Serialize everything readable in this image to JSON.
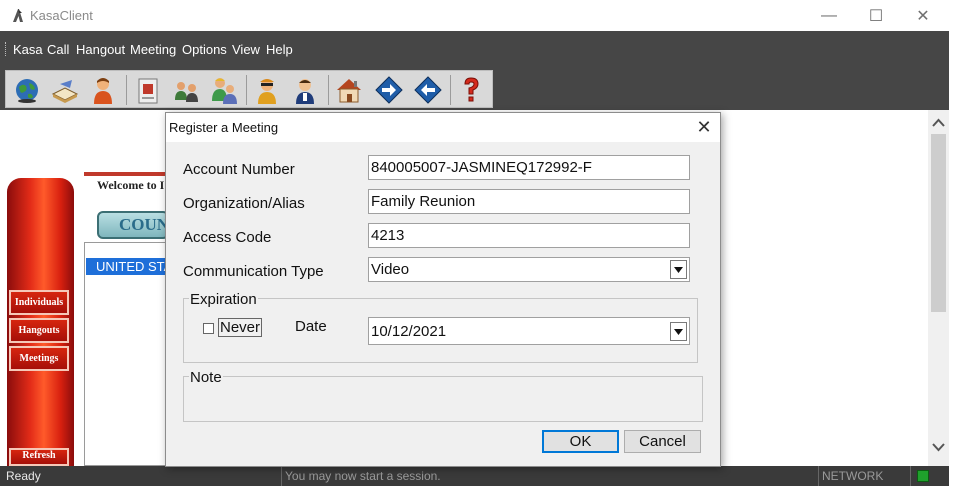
{
  "window": {
    "title": "KasaClient",
    "minimize": "—",
    "maximize": "☐",
    "close": "✕"
  },
  "menu": [
    "Kasa",
    "Call",
    "Hangout",
    "Meeting",
    "Options",
    "View",
    "Help"
  ],
  "toolbar": {
    "buttons": [
      "globe-icon",
      "book-icon",
      "user-icon",
      "id-card-icon",
      "connect-users-icon",
      "group-icon",
      "agent-icon",
      "operator-icon",
      "home-icon",
      "forward-icon",
      "back-icon",
      "help-icon"
    ]
  },
  "background": {
    "welcome": "Welcome to I",
    "country_button": "COUNTRY",
    "list_selected": "UNITED STATES",
    "side_buttons": [
      "Individuals",
      "Hangouts",
      "Meetings",
      "Refresh"
    ]
  },
  "dialog": {
    "title": "Register a Meeting",
    "close": "✕",
    "account_number_label": "Account Number",
    "account_number_value": "840005007-JASMINEQ172992-F",
    "org_label": "Organization/Alias",
    "org_value": "Family Reunion",
    "access_code_label": "Access Code",
    "access_code_value": "4213",
    "comm_type_label": "Communication Type",
    "comm_type_value": "Video",
    "expiration_label": "Expiration",
    "never_label": "Never",
    "never_checked": false,
    "date_label": "Date",
    "date_value": "10/12/2021",
    "note_label": "Note",
    "ok": "OK",
    "cancel": "Cancel"
  },
  "status": {
    "ready": "Ready",
    "message": "You may now start a session.",
    "network": "NETWORK",
    "network_led_color": "#1fa12c"
  }
}
